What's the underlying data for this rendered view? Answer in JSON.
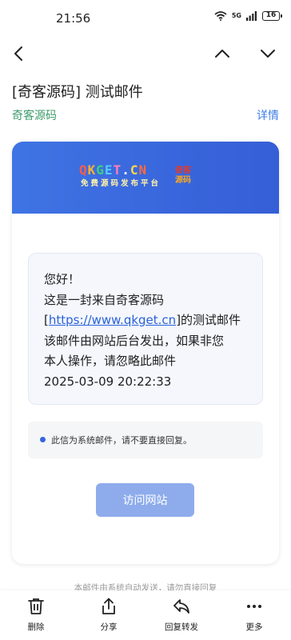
{
  "status_bar": {
    "time": "21:56",
    "signal_label": "5G",
    "battery": "16"
  },
  "email": {
    "subject": "[奇客源码] 测试邮件",
    "sender": "奇客源码",
    "details_label": "详情"
  },
  "card": {
    "logo": {
      "brand": "QKGET.CN",
      "tagline": "免费源码发布平台",
      "side_line1": "奇客",
      "side_line2": "源码"
    },
    "message": {
      "greeting": "您好！",
      "line2": "这是一封来自奇客源码",
      "link_open": "[",
      "link": "https://www.qkget.cn",
      "link_close": "]的测试邮件",
      "line4": "该邮件由网站后台发出，如果非您",
      "line5": "本人操作，请忽略此邮件",
      "timestamp": "2025-03-09 20:22:33"
    },
    "notice": "此信为系统邮件，请不要直接回复。",
    "visit_button": "访问网站"
  },
  "footer_note": "本邮件由系统自动发送，请勿直接回复",
  "toolbar": {
    "delete": "删除",
    "share": "分享",
    "reply_forward": "回复转发",
    "more": "更多"
  },
  "colors": {
    "header_blue": "#3966dc",
    "sender_green": "#3c9b6a",
    "link_blue": "#2a62d6",
    "button_blue": "#8eacec"
  }
}
